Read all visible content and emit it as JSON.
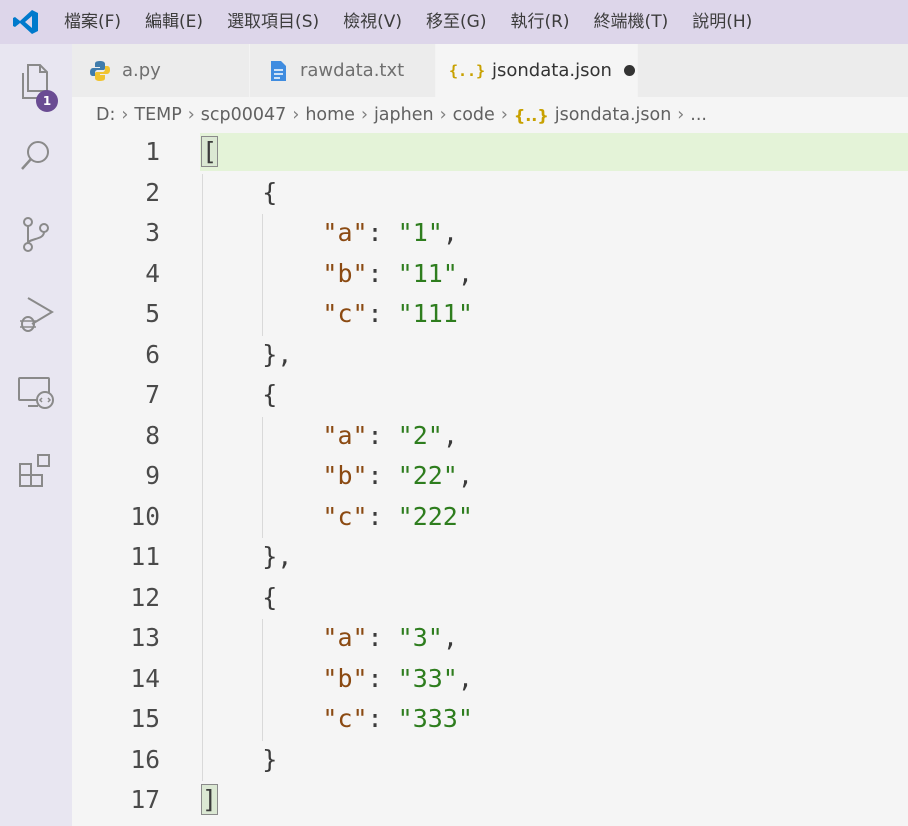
{
  "menu": [
    "檔案(F)",
    "編輯(E)",
    "選取項目(S)",
    "檢視(V)",
    "移至(G)",
    "執行(R)",
    "終端機(T)",
    "說明(H)"
  ],
  "activity": {
    "explorer_badge": "1"
  },
  "tabs": [
    {
      "label": "a.py",
      "icon": "python-icon",
      "active": false
    },
    {
      "label": "rawdata.txt",
      "icon": "text-file-icon",
      "active": false
    },
    {
      "label": "jsondata.json",
      "icon": "json-icon",
      "active": true,
      "unsaved": true
    }
  ],
  "breadcrumb": [
    "D:",
    "TEMP",
    "scp00047",
    "home",
    "japhen",
    "code",
    "jsondata.json",
    "..."
  ],
  "json_icon_glyph": "{..}",
  "editor": {
    "line_numbers": [
      "1",
      "2",
      "3",
      "4",
      "5",
      "6",
      "7",
      "8",
      "9",
      "10",
      "11",
      "12",
      "13",
      "14",
      "15",
      "16",
      "17"
    ],
    "objects": [
      {
        "a": "1",
        "b": "11",
        "c": "111"
      },
      {
        "a": "2",
        "b": "22",
        "c": "222"
      },
      {
        "a": "3",
        "b": "33",
        "c": "333"
      }
    ],
    "tokens": {
      "open_array": "[",
      "close_array": "]",
      "open_obj": "{",
      "close_obj": "}",
      "close_obj_comma": "},",
      "colon": ": ",
      "comma": ","
    }
  },
  "colors": {
    "accent": "#6a4c93",
    "vscode_blue": "#007acc",
    "key": "#8b4a12",
    "string": "#2e7d1e"
  }
}
